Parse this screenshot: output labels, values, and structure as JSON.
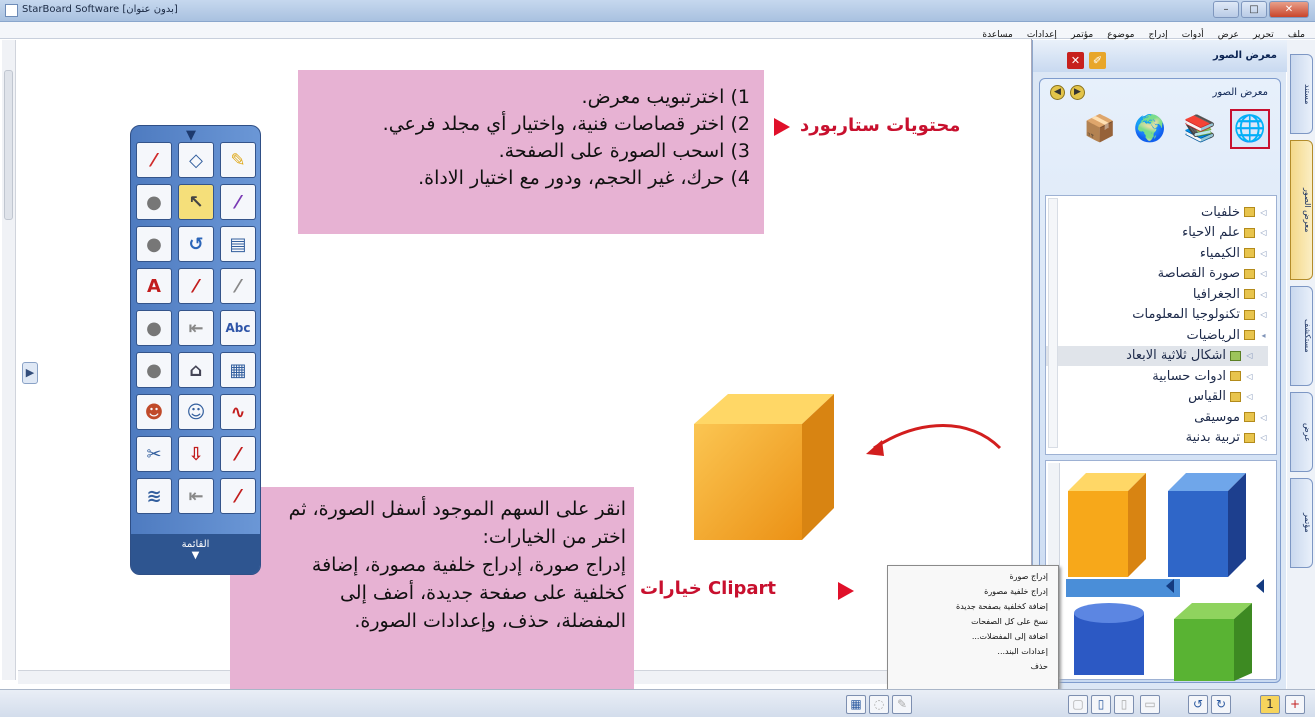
{
  "window": {
    "title": "StarBoard Software [بدون عنوان]"
  },
  "menubar": [
    "ملف",
    "تحرير",
    "عرض",
    "أدوات",
    "إدراج",
    "موضوع",
    "مؤتمر",
    "إعدادات",
    "مساعدة"
  ],
  "instructions_box": {
    "lines": [
      "1) اخترتبويب معرض.",
      "2) اختر قصاصات فنية، واختيار أي مجلد فرعي.",
      "3) اسحب الصورة على الصفحة.",
      "4) حرك، غير الحجم، ودور مع اختيار الاداة."
    ]
  },
  "starboard_label": "محتويات ستاربورد",
  "clipart_label": "خيارات Clipart",
  "options_box": {
    "lines": [
      "انقر على السهم الموجود أسفل الصورة، ثم",
      "اختر من الخيارات:",
      "إدراج صورة، إدراج خلفية مصورة، إضافة",
      "كخلفية على صفحة جديدة، أضف إلى",
      "المفضلة، حذف، وإعدادات الصورة."
    ]
  },
  "toolbox": {
    "footer_label": "القائمة"
  },
  "gallery_panel": {
    "header": "معرض الصور",
    "subtitle": "معرض الصور",
    "icons": [
      "globe-box-icon",
      "books-icon",
      "globe-arrow-icon",
      "open-box-icon"
    ],
    "tree": [
      {
        "label": "خلفيات",
        "selected": false
      },
      {
        "label": "علم الاحياء",
        "selected": false
      },
      {
        "label": "الكيمياء",
        "selected": false
      },
      {
        "label": "صورة القصاصة",
        "selected": false
      },
      {
        "label": "الجغرافيا",
        "selected": false
      },
      {
        "label": "تكنولوجيا المعلومات",
        "selected": false
      },
      {
        "label": "الرياضيات",
        "selected": false
      },
      {
        "label": "اشكال ثلاثية الابعاد",
        "selected": true
      },
      {
        "label": "ادوات حسابية",
        "selected": false
      },
      {
        "label": "القياس",
        "selected": false
      },
      {
        "label": "موسيقى",
        "selected": false
      },
      {
        "label": "تربية بدنية",
        "selected": false
      }
    ]
  },
  "side_tabs": [
    "مستند",
    "معرض الصور",
    "مستكشف",
    "عرض",
    "مؤتمر"
  ],
  "context_menu": [
    "إدراج صورة",
    "إدراج خلفية مصورة",
    "إضافة كخلفية بصفحة جديدة",
    "نسخ على كل الصفحات",
    "اضافة إلى المفضلات...",
    "إعدادات البند...",
    "حذف"
  ],
  "colors": {
    "pink": "#e7b2d3",
    "accent_red": "#c8102e",
    "panel_blue": "#4e7bc0"
  }
}
